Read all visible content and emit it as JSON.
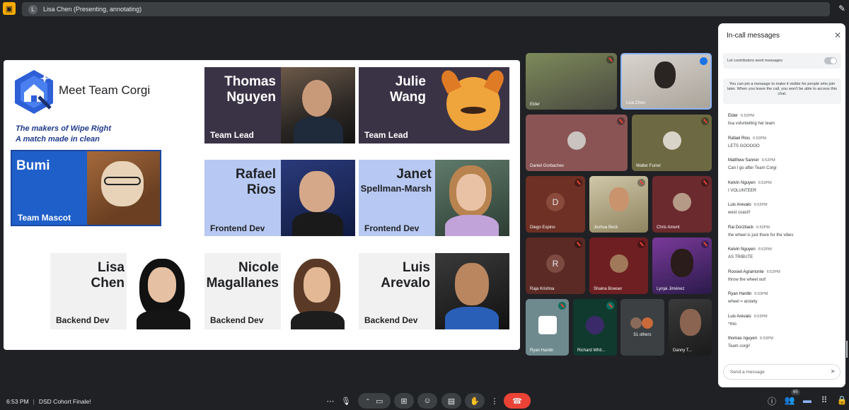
{
  "top_bar": {
    "presenter_initial": "L",
    "presenter_text": "Lisa Chen (Presenting, annotating)"
  },
  "slide": {
    "title": "Meet Team Corgi",
    "tagline_1": "The makers of Wipe Right",
    "tagline_2": "A match made in clean",
    "cards": [
      {
        "name": "Thomas\nNguyen",
        "role": "Team Lead"
      },
      {
        "name": "Julie\nWang",
        "role": "Team Lead"
      },
      {
        "name": "Bumi",
        "role": "Team Mascot"
      },
      {
        "name": "Rafael\nRios",
        "role": "Frontend Dev"
      },
      {
        "name": "Janet",
        "name2": "Spellman-Marsh",
        "role": "Frontend Dev"
      },
      {
        "name": "Lisa\nChen",
        "role": "Backend Dev"
      },
      {
        "name": "Nicole\nMagallanes",
        "role": "Backend Dev"
      },
      {
        "name": "Luis\nArevalo",
        "role": "Backend Dev"
      }
    ]
  },
  "participants": [
    {
      "name": "Elder"
    },
    {
      "name": "Lisa Chen"
    },
    {
      "name": "Daniel Gorbachev"
    },
    {
      "name": "Walter Furrer"
    },
    {
      "name": "Diego Espino",
      "initial": "D"
    },
    {
      "name": "Joshua Beck"
    },
    {
      "name": "Chris Ament"
    },
    {
      "name": "Raja Krishna",
      "initial": "R"
    },
    {
      "name": "Shaina Bowser"
    },
    {
      "name": "Lynjai Jiménez"
    },
    {
      "name": "Ryan Hardin"
    },
    {
      "name": "Richard Whit..."
    },
    {
      "name": "51 others"
    },
    {
      "name": "Danny T..."
    }
  ],
  "chat": {
    "title": "In-call messages",
    "toggle_label": "Let contributors send messages",
    "pin_info": "You can pin a message to make it visible for people who join later. When you leave the call, you won't be able to access this chat.",
    "messages": [
      {
        "author": "Elder",
        "time": "6:52PM",
        "text": "lisa voluntelling her team"
      },
      {
        "author": "Rafael Rios",
        "time": "6:52PM",
        "text": "LETS GOOOOO"
      },
      {
        "author": "Matthew Sanner",
        "time": "6:52PM",
        "text": "Can I go after Team Corgi"
      },
      {
        "author": "Kelvin Nguyen",
        "time": "6:52PM",
        "text": "I VOLUNTEER"
      },
      {
        "author": "Luis Arevalo",
        "time": "6:52PM",
        "text": "west coast!!"
      },
      {
        "author": "Rai Dorzback",
        "time": "6:52PM",
        "text": "the wheel is just there for the vibes"
      },
      {
        "author": "Kelvin Nguyen",
        "time": "6:52PM",
        "text": "AS TRIBUTE"
      },
      {
        "author": "Roosiel Agramonte",
        "time": "6:52PM",
        "text": "throw the wheel out!"
      },
      {
        "author": "Ryan Hardin",
        "time": "6:53PM",
        "text": "wheel = anxiety"
      },
      {
        "author": "Luis Arevalo",
        "time": "6:53PM",
        "text": "^this"
      },
      {
        "author": "thomas nguyen",
        "time": "6:53PM",
        "text": "Team corgi!"
      }
    ],
    "input_placeholder": "Send a message"
  },
  "bottom": {
    "time": "6:53 PM",
    "separator": "|",
    "meeting_name": "DSD Cohort Finale!",
    "people_count": "65"
  },
  "colors": {
    "background": "#202124",
    "control": "#3c4043",
    "end_call": "#ea4335",
    "slide_blue": "#1f5fc9",
    "slide_light_blue": "#b7c9f2",
    "slide_dark": "#3a3346"
  }
}
